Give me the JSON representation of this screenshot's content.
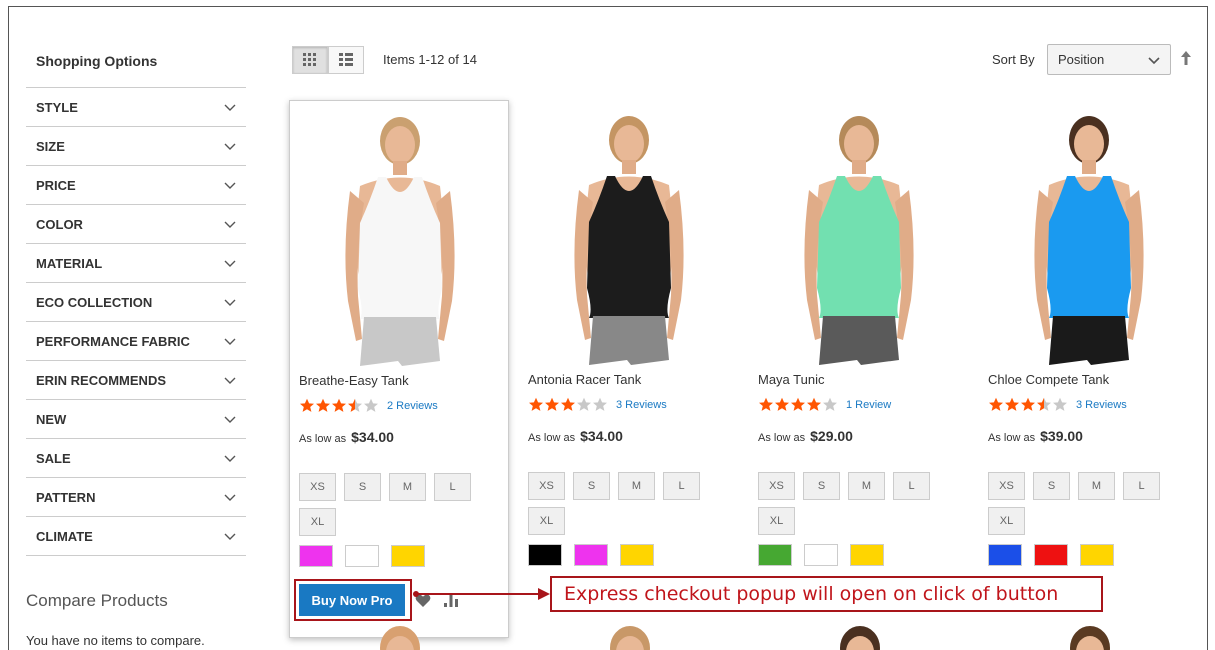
{
  "sidebar": {
    "title": "Shopping Options",
    "filters": [
      "STYLE",
      "SIZE",
      "PRICE",
      "COLOR",
      "MATERIAL",
      "ECO COLLECTION",
      "PERFORMANCE FABRIC",
      "ERIN RECOMMENDS",
      "NEW",
      "SALE",
      "PATTERN",
      "CLIMATE"
    ],
    "compare_title": "Compare Products",
    "compare_text": "You have no items to compare."
  },
  "toolbar": {
    "items_count": "Items 1-12 of 14",
    "sort_label": "Sort By",
    "sort_value": "Position",
    "view_modes": [
      "grid-icon",
      "list-icon"
    ],
    "active_mode": "grid"
  },
  "products": [
    {
      "name": "Breathe-Easy Tank",
      "rating": 3.5,
      "reviews": "2 Reviews",
      "price_prefix": "As low as",
      "price": "$34.00",
      "sizes": [
        "XS",
        "S",
        "M",
        "L",
        "XL"
      ],
      "colors": [
        "#ee33ee",
        "#ffffff",
        "#ffd500"
      ],
      "top_color": "#f7f7f7",
      "bottom_color": "#c8c8c8"
    },
    {
      "name": "Antonia Racer Tank",
      "rating": 3,
      "reviews": "3 Reviews",
      "price_prefix": "As low as",
      "price": "$34.00",
      "sizes": [
        "XS",
        "S",
        "M",
        "L",
        "XL"
      ],
      "colors": [
        "#000000",
        "#ee33ee",
        "#ffd500"
      ],
      "top_color": "#1c1c1c",
      "bottom_color": "#888888"
    },
    {
      "name": "Maya Tunic",
      "rating": 4,
      "reviews": "1 Review",
      "price_prefix": "As low as",
      "price": "$29.00",
      "sizes": [
        "XS",
        "S",
        "M",
        "L",
        "XL"
      ],
      "colors": [
        "#46a832",
        "#ffffff",
        "#ffd500"
      ],
      "top_color": "#72e0b0",
      "bottom_color": "#5a5a5a"
    },
    {
      "name": "Chloe Compete Tank",
      "rating": 3.5,
      "reviews": "3 Reviews",
      "price_prefix": "As low as",
      "price": "$39.00",
      "sizes": [
        "XS",
        "S",
        "M",
        "L",
        "XL"
      ],
      "colors": [
        "#1b4fe8",
        "#ee1111",
        "#ffd500"
      ],
      "top_color": "#1a9af0",
      "bottom_color": "#1a1a1a"
    }
  ],
  "actions": {
    "buy_label": "Buy Now Pro",
    "wishlist_icon": "heart-icon",
    "compare_icon": "bar-chart-icon"
  },
  "callout": {
    "text": "Express checkout popup will open on click of button"
  },
  "colors": {
    "accent": "#1979c3",
    "star": "#ff5501",
    "callout_border": "#a8151a"
  }
}
